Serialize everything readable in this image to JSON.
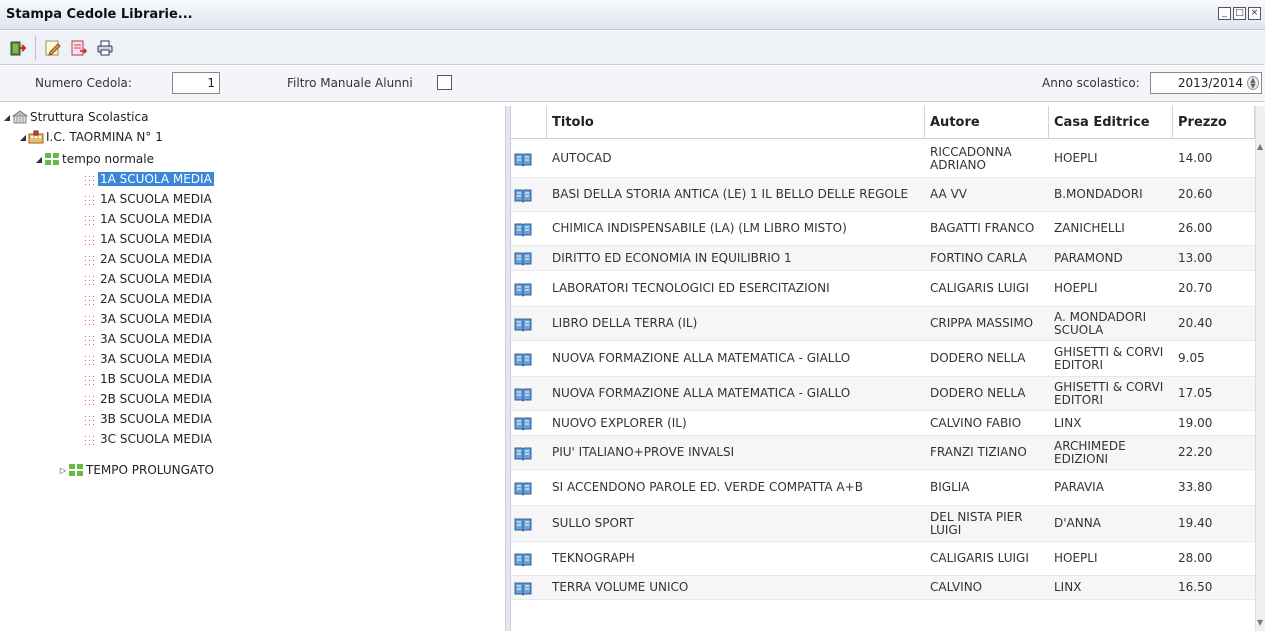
{
  "window": {
    "title": "Stampa Cedole Librarie...",
    "buttons": [
      "minimize-icon",
      "maximize-icon",
      "close-icon"
    ]
  },
  "toolbar": {
    "icons": [
      "exit-icon",
      "edit-icon",
      "export-icon",
      "print-icon"
    ]
  },
  "filters": {
    "numero_label": "Numero Cedola:",
    "numero_value": "1",
    "filtro_label": "Filtro Manuale Alunni",
    "filtro_checked": false,
    "anno_label": "Anno scolastico:",
    "anno_value": "2013/2014"
  },
  "tree": {
    "root": "Struttura Scolastica",
    "school": "I.C. TAORMINA N° 1",
    "group1": "tempo normale",
    "classes": [
      "1A SCUOLA MEDIA",
      "1A SCUOLA MEDIA",
      "1A SCUOLA MEDIA",
      "1A SCUOLA MEDIA",
      "2A SCUOLA MEDIA",
      "2A SCUOLA MEDIA",
      "2A SCUOLA MEDIA",
      "3A SCUOLA MEDIA",
      "3A SCUOLA MEDIA",
      "3A SCUOLA MEDIA",
      "1B SCUOLA MEDIA",
      "2B SCUOLA MEDIA",
      "3B SCUOLA MEDIA",
      "3C SCUOLA MEDIA"
    ],
    "selected_index": 0,
    "group2": "TEMPO PROLUNGATO"
  },
  "table": {
    "headers": {
      "titolo": "Titolo",
      "autore": "Autore",
      "casa": "Casa Editrice",
      "prezzo": "Prezzo"
    },
    "rows": [
      {
        "titolo": "AUTOCAD",
        "autore": "RICCADONNA ADRIANO",
        "casa": "HOEPLI",
        "prezzo": "14.00"
      },
      {
        "titolo": "BASI DELLA STORIA ANTICA (LE) 1 IL BELLO DELLE REGOLE",
        "autore": "AA VV",
        "casa": "B.MONDADORI",
        "prezzo": "20.60"
      },
      {
        "titolo": "CHIMICA INDISPENSABILE (LA) (LM LIBRO MISTO)",
        "autore": "BAGATTI FRANCO",
        "casa": "ZANICHELLI",
        "prezzo": "26.00"
      },
      {
        "titolo": "DIRITTO ED ECONOMIA IN EQUILIBRIO 1",
        "autore": "FORTINO CARLA",
        "casa": "PARAMOND",
        "prezzo": "13.00"
      },
      {
        "titolo": "LABORATORI TECNOLOGICI ED ESERCITAZIONI",
        "autore": "CALIGARIS LUIGI",
        "casa": "HOEPLI",
        "prezzo": "20.70"
      },
      {
        "titolo": "LIBRO DELLA TERRA (IL)",
        "autore": "CRIPPA MASSIMO",
        "casa": "A. MONDADORI SCUOLA",
        "prezzo": "20.40"
      },
      {
        "titolo": "NUOVA FORMAZIONE ALLA MATEMATICA - GIALLO",
        "autore": "DODERO NELLA",
        "casa": "GHISETTI & CORVI EDITORI",
        "prezzo": "9.05"
      },
      {
        "titolo": "NUOVA FORMAZIONE ALLA MATEMATICA - GIALLO",
        "autore": "DODERO NELLA",
        "casa": "GHISETTI & CORVI EDITORI",
        "prezzo": "17.05"
      },
      {
        "titolo": "NUOVO EXPLORER (IL)",
        "autore": "CALVINO FABIO",
        "casa": "LINX",
        "prezzo": "19.00"
      },
      {
        "titolo": "PIU' ITALIANO+PROVE INVALSI",
        "autore": "FRANZI TIZIANO",
        "casa": "ARCHIMEDE EDIZIONI",
        "prezzo": "22.20"
      },
      {
        "titolo": "SI ACCENDONO PAROLE ED. VERDE COMPATTA A+B",
        "autore": "BIGLIA",
        "casa": "PARAVIA",
        "prezzo": "33.80"
      },
      {
        "titolo": "SULLO SPORT",
        "autore": "DEL NISTA PIER LUIGI",
        "casa": "D'ANNA",
        "prezzo": "19.40"
      },
      {
        "titolo": "TEKNOGRAPH",
        "autore": "CALIGARIS LUIGI",
        "casa": "HOEPLI",
        "prezzo": "28.00"
      },
      {
        "titolo": "TERRA VOLUME UNICO",
        "autore": "CALVINO",
        "casa": "LINX",
        "prezzo": "16.50"
      }
    ]
  },
  "colors": {
    "selection": "#3a86d8",
    "book_icon": "#6aa0d8"
  }
}
